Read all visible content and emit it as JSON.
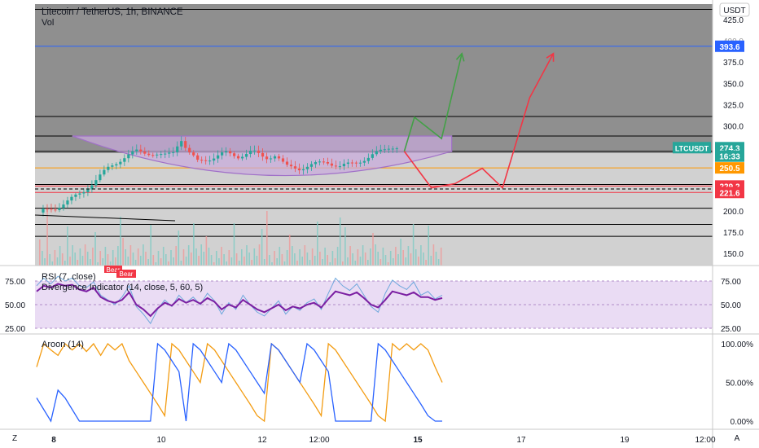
{
  "header": {
    "title": "Litecoin / TetherUS, 1h, BINANCE",
    "volume_label": "Vol"
  },
  "currency_button": "USDT",
  "corner_buttons": {
    "left": "Z",
    "right": "A"
  },
  "x_axis_labels": [
    "8",
    "10",
    "12",
    "12:00",
    "15",
    "17",
    "19",
    "12:00"
  ],
  "chart_data": [
    {
      "type": "line",
      "name": "price",
      "y_axis_labels": [
        "425.0",
        "400.0",
        "375.0",
        "350.0",
        "325.0",
        "300.0",
        "275.0",
        "250.0",
        "225.0",
        "200.0",
        "175.0",
        "150.0"
      ],
      "ylim": [
        140,
        440
      ],
      "price_badges": [
        {
          "text": "393.6",
          "value": 393.6,
          "color": "#2962ff"
        },
        {
          "text": "LTCUSDT",
          "value": 274.3,
          "color": "#26a69a"
        },
        {
          "text": "274.3",
          "value": 274.3,
          "color": "#26a69a"
        },
        {
          "text": "16:33",
          "value": 264.3,
          "color": "#26a69a"
        },
        {
          "text": "250.5",
          "value": 250.5,
          "color": "#ff9800"
        },
        {
          "text": "229.2",
          "value": 229.2,
          "color": "#f23645"
        },
        {
          "text": "221.6",
          "value": 221.6,
          "color": "#f23645"
        }
      ],
      "horizontal_levels": [
        {
          "value": 437,
          "color": "#000000"
        },
        {
          "value": 393.6,
          "color": "#2962ff"
        },
        {
          "value": 311,
          "color": "#000000"
        },
        {
          "value": 288,
          "color": "#000000"
        },
        {
          "value": 270,
          "color": "#000000"
        },
        {
          "value": 250.5,
          "color": "#ff9800"
        },
        {
          "value": 231,
          "color": "#000000"
        },
        {
          "value": 229.2,
          "color": "#f23645"
        },
        {
          "value": 221.6,
          "color": "#f23645"
        },
        {
          "value": 203,
          "color": "#000000"
        },
        {
          "value": 184,
          "color": "#000000"
        },
        {
          "value": 170,
          "color": "#000000"
        }
      ],
      "price_path": [
        [
          0,
          198
        ],
        [
          0.03,
          203
        ],
        [
          0.05,
          212
        ],
        [
          0.07,
          222
        ],
        [
          0.09,
          236
        ],
        [
          0.11,
          252
        ],
        [
          0.13,
          262
        ],
        [
          0.15,
          270
        ],
        [
          0.17,
          268
        ],
        [
          0.19,
          264
        ],
        [
          0.205,
          270
        ],
        [
          0.215,
          286
        ],
        [
          0.225,
          270
        ],
        [
          0.24,
          258
        ],
        [
          0.26,
          262
        ],
        [
          0.28,
          268
        ],
        [
          0.3,
          264
        ],
        [
          0.32,
          270
        ],
        [
          0.34,
          262
        ],
        [
          0.355,
          266
        ],
        [
          0.37,
          252
        ],
        [
          0.39,
          250
        ],
        [
          0.41,
          254
        ],
        [
          0.43,
          258
        ],
        [
          0.45,
          252
        ],
        [
          0.47,
          256
        ],
        [
          0.49,
          262
        ],
        [
          0.51,
          270
        ],
        [
          0.525,
          276
        ],
        [
          0.54,
          274.3
        ]
      ],
      "projection_green": [
        [
          0.545,
          270
        ],
        [
          0.56,
          310
        ],
        [
          0.6,
          285
        ],
        [
          0.63,
          385
        ]
      ],
      "projection_red": [
        [
          0.545,
          270
        ],
        [
          0.585,
          227
        ],
        [
          0.62,
          232
        ],
        [
          0.66,
          250
        ],
        [
          0.69,
          227
        ],
        [
          0.73,
          333
        ],
        [
          0.765,
          385
        ]
      ]
    },
    {
      "type": "line",
      "name": "RSI (7, close)",
      "label": "RSI (7, close)",
      "label2": "Divergence Indicator (14, close, 5, 60, 5)",
      "badges": [
        "Bear",
        "Bear"
      ],
      "y_axis_labels": [
        "75.00",
        "50.00",
        "25.00"
      ],
      "left_axis_labels": [
        "75.00",
        "50.00",
        "25.00"
      ],
      "ylim": [
        20,
        82
      ],
      "rsi_fast": [
        70,
        78,
        72,
        80,
        75,
        78,
        70,
        68,
        74,
        60,
        55,
        50,
        58,
        70,
        48,
        40,
        30,
        45,
        55,
        48,
        60,
        52,
        58,
        50,
        62,
        54,
        40,
        52,
        45,
        60,
        50,
        42,
        38,
        46,
        54,
        40,
        48,
        44,
        52,
        56,
        45,
        62,
        78,
        70,
        65,
        72,
        60,
        48,
        42,
        62,
        76,
        70,
        66,
        74,
        60,
        64,
        56,
        60
      ],
      "rsi_slow": [
        64,
        70,
        68,
        72,
        70,
        71,
        66,
        64,
        68,
        58,
        54,
        52,
        55,
        63,
        50,
        45,
        38,
        46,
        52,
        49,
        56,
        52,
        55,
        51,
        57,
        53,
        45,
        50,
        47,
        55,
        50,
        45,
        42,
        46,
        50,
        44,
        48,
        46,
        50,
        52,
        47,
        56,
        64,
        62,
        60,
        63,
        57,
        50,
        47,
        55,
        64,
        62,
        60,
        63,
        58,
        58,
        55,
        57
      ]
    },
    {
      "type": "line",
      "name": "Aroon (14)",
      "label": "Aroon (14)",
      "y_axis_labels": [
        "100.00%",
        "50.00%",
        "0.00%"
      ],
      "ylim": [
        0,
        100
      ],
      "aroon_up": [
        70,
        100,
        92,
        85,
        100,
        92,
        100,
        90,
        100,
        85,
        100,
        92,
        100,
        78,
        64,
        50,
        36,
        22,
        7,
        100,
        92,
        78,
        64,
        50,
        100,
        92,
        78,
        64,
        50,
        36,
        22,
        7,
        0,
        100,
        92,
        78,
        64,
        50,
        36,
        22,
        7,
        100,
        92,
        78,
        64,
        50,
        36,
        22,
        7,
        0,
        100,
        92,
        100,
        92,
        100,
        92,
        70,
        50
      ],
      "aroon_down": [
        30,
        15,
        0,
        40,
        30,
        15,
        0,
        0,
        0,
        0,
        0,
        0,
        0,
        0,
        0,
        0,
        0,
        100,
        92,
        78,
        64,
        0,
        100,
        92,
        78,
        64,
        50,
        100,
        92,
        78,
        64,
        50,
        36,
        100,
        92,
        78,
        64,
        50,
        100,
        92,
        78,
        64,
        0,
        0,
        0,
        0,
        0,
        0,
        100,
        92,
        78,
        64,
        50,
        36,
        22,
        7,
        0,
        0
      ]
    }
  ]
}
